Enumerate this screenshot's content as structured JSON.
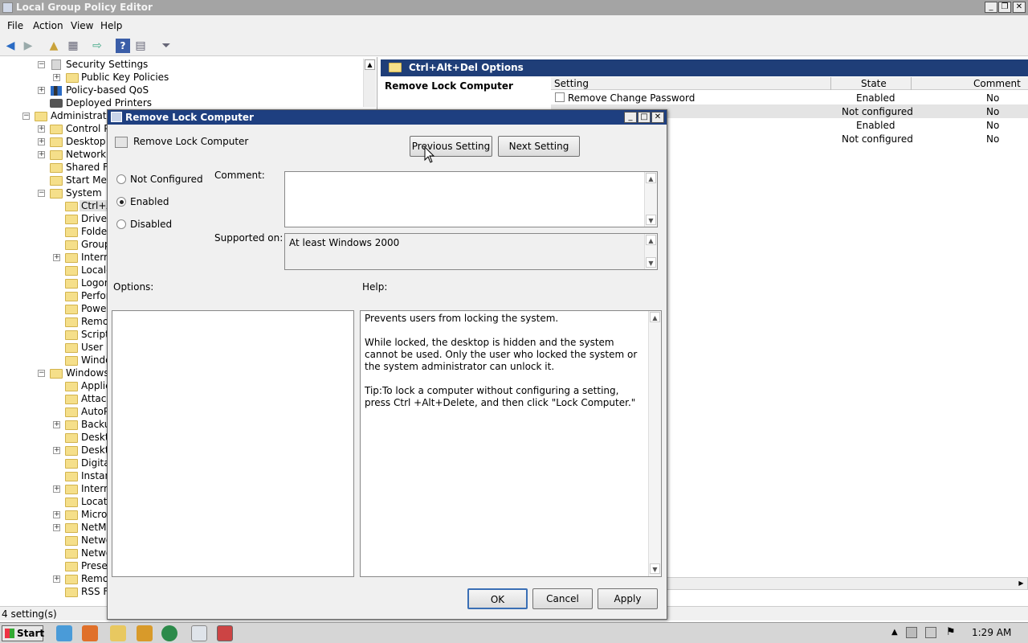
{
  "window": {
    "title": "Local Group Policy Editor"
  },
  "menu": [
    "File",
    "Action",
    "View",
    "Help"
  ],
  "tree": [
    {
      "label": "Security Settings",
      "expander": "−"
    },
    {
      "label": "Public Key Policies",
      "expander": "+"
    },
    {
      "label": "Policy-based QoS",
      "expander": "+"
    },
    {
      "label": "Deployed Printers",
      "expander": ""
    },
    {
      "label": "Administrative",
      "expander": "−"
    },
    {
      "label": "Control Pa",
      "expander": "+"
    },
    {
      "label": "Desktop",
      "expander": "+"
    },
    {
      "label": "Network",
      "expander": "+"
    },
    {
      "label": "Shared Fo",
      "expander": ""
    },
    {
      "label": "Start Menu",
      "expander": ""
    },
    {
      "label": "System",
      "expander": "−"
    },
    {
      "label": "Ctrl+A",
      "expander": ""
    },
    {
      "label": "Driver",
      "expander": ""
    },
    {
      "label": "Folder",
      "expander": ""
    },
    {
      "label": "Group",
      "expander": ""
    },
    {
      "label": "Intern",
      "expander": "+"
    },
    {
      "label": "Locale",
      "expander": ""
    },
    {
      "label": "Logon",
      "expander": ""
    },
    {
      "label": "Perfor",
      "expander": ""
    },
    {
      "label": "Power",
      "expander": ""
    },
    {
      "label": "Remov",
      "expander": ""
    },
    {
      "label": "Scripts",
      "expander": ""
    },
    {
      "label": "User P",
      "expander": ""
    },
    {
      "label": "Windo",
      "expander": ""
    },
    {
      "label": "Windows C",
      "expander": "−"
    },
    {
      "label": "Applica",
      "expander": ""
    },
    {
      "label": "Attach",
      "expander": ""
    },
    {
      "label": "AutoPl",
      "expander": ""
    },
    {
      "label": "Backup",
      "expander": "+"
    },
    {
      "label": "Deskto",
      "expander": ""
    },
    {
      "label": "Deskto",
      "expander": "+"
    },
    {
      "label": "Digital",
      "expander": ""
    },
    {
      "label": "Instan",
      "expander": ""
    },
    {
      "label": "Intern",
      "expander": "+"
    },
    {
      "label": "Locatio",
      "expander": ""
    },
    {
      "label": "Micros",
      "expander": "+"
    },
    {
      "label": "NetMe",
      "expander": "+"
    },
    {
      "label": "Netwo",
      "expander": ""
    },
    {
      "label": "Netwo",
      "expander": ""
    },
    {
      "label": "Preser",
      "expander": ""
    },
    {
      "label": "Remot",
      "expander": "+"
    },
    {
      "label": "RSS Fe",
      "expander": ""
    }
  ],
  "right": {
    "header": "Ctrl+Alt+Del Options",
    "policy_title": "Remove Lock Computer",
    "columns": {
      "setting": "Setting",
      "state": "State",
      "comment": "Comment"
    },
    "rows": [
      {
        "setting": "Remove Change Password",
        "state": "Enabled",
        "comment": "No"
      },
      {
        "setting": "",
        "state": "Not configured",
        "comment": "No"
      },
      {
        "setting": "",
        "state": "Enabled",
        "comment": "No"
      },
      {
        "setting": "",
        "state": "Not configured",
        "comment": "No"
      }
    ]
  },
  "status": {
    "text": "4 setting(s)"
  },
  "dialog": {
    "title": "Remove Lock Computer",
    "policy_name": "Remove Lock Computer",
    "prev_label": "Previous Setting",
    "next_label": "Next Setting",
    "options": {
      "not_configured": "Not Configured",
      "enabled": "Enabled",
      "disabled": "Disabled"
    },
    "selected": "enabled",
    "comment_label": "Comment:",
    "comment_value": "",
    "supported_label": "Supported on:",
    "supported_value": "At least Windows 2000",
    "options_label": "Options:",
    "help_label": "Help:",
    "help_p1": "Prevents users from locking the system.",
    "help_p2": "While locked, the desktop is hidden and the system cannot be used. Only the user who locked the system or the system administrator can unlock it.",
    "help_p3": "Tip:To lock a computer without configuring a setting, press Ctrl +Alt+Delete, and then click \"Lock Computer.\"",
    "ok": "OK",
    "cancel": "Cancel",
    "apply": "Apply"
  },
  "taskbar": {
    "start": "Start",
    "clock": "1:29 AM"
  },
  "colors": {
    "dialog_title": "#1e3f80",
    "pane_header": "#1f3e78",
    "folder": "#f5df8a"
  }
}
